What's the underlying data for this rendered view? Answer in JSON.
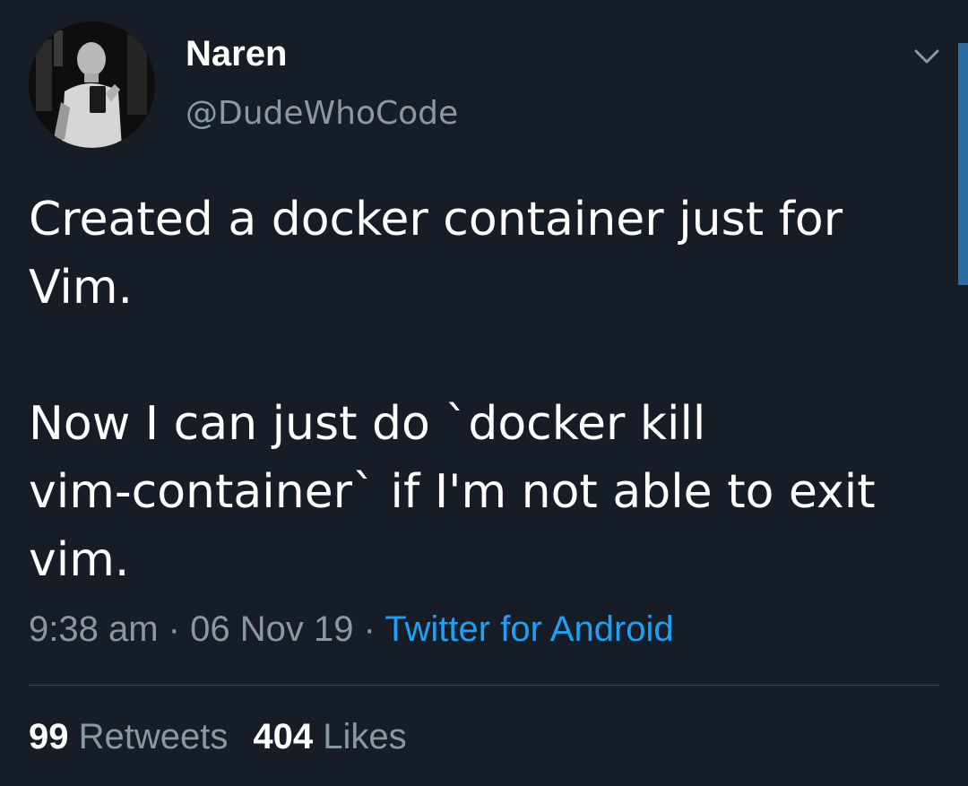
{
  "author": {
    "display_name": "Naren",
    "handle": "@DudeWhoCode",
    "avatar_icon": "profile-photo"
  },
  "tweet": {
    "lines_para1": [
      "Created a docker container just for",
      "Vim."
    ],
    "lines_para2": [
      "Now I can just do `docker kill",
      "vim-container` if I'm not able to exit",
      "vim."
    ]
  },
  "meta": {
    "time": "9:38 am",
    "separator": "·",
    "date": "06 Nov 19",
    "source": "Twitter for Android"
  },
  "stats": {
    "retweets_count": "99",
    "retweets_label": "Retweets",
    "likes_count": "404",
    "likes_label": "Likes"
  },
  "icons": {
    "menu": "chevron-down-icon"
  },
  "colors": {
    "background": "#161d27",
    "secondary_text": "#8899a6",
    "link": "#1da1f2",
    "divider": "#38444d"
  }
}
